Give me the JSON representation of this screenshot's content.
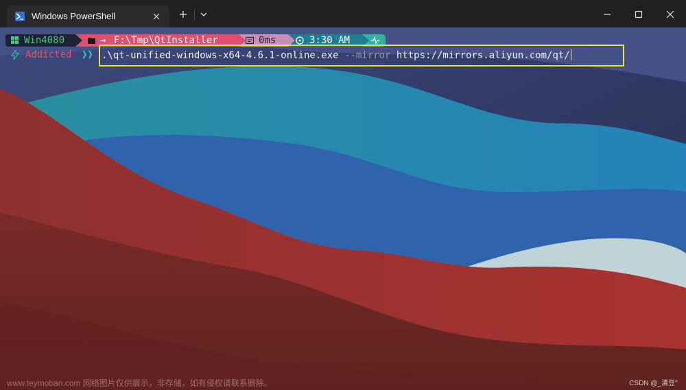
{
  "window": {
    "tab_title": "Windows PowerShell",
    "tab_icon": "powershell-icon",
    "new_tab_icon": "plus-icon",
    "dropdown_icon": "chevron-down-icon",
    "controls": [
      "minimize-icon",
      "maximize-icon",
      "close-icon"
    ]
  },
  "prompt": {
    "host": "Win4080",
    "arrow": "→",
    "path": "F:\\Tmp\\QtInstaller",
    "duration": "0ms",
    "time": "3:30 AM",
    "status": "Addicted",
    "chevrons": "❱❱"
  },
  "command": {
    "exe": ".\\qt-unified-windows-x64-4.6.1-online.exe",
    "flag": "--mirror",
    "url": "https://mirrors.aliyun.com/qt/"
  },
  "watermark": {
    "left": "www.teymoban.com 网络图片仅供展示，非存储，如有侵权请联系删除。",
    "right": "CSDN @_清豆°"
  },
  "colors": {
    "host_segment": "#1f2236",
    "host_text": "#3ad07a",
    "path_segment": "#e0506c",
    "duration_segment": "#c58fb8",
    "time_segment": "#1f7f90",
    "status_segment": "#2fb39e",
    "highlight_border": "#e7e53c"
  }
}
